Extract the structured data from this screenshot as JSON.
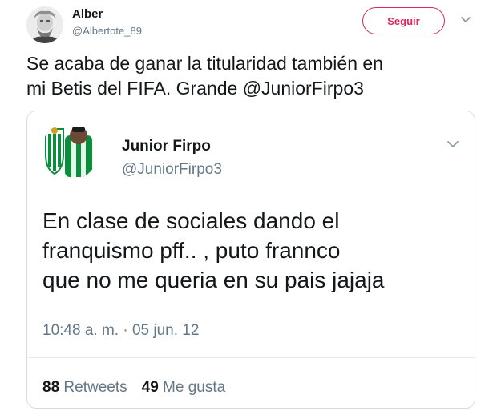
{
  "author": {
    "name": "Alber",
    "handle": "@Albertote_89",
    "follow_label": "Seguir"
  },
  "tweet": {
    "text_line1": "Se acaba de ganar la titularidad también en",
    "text_line2": "mi Betis del FIFA. Grande @JuniorFirpo3"
  },
  "quoted": {
    "name": "Junior Firpo",
    "handle": "@JuniorFirpo3",
    "text_line1": "En clase de sociales dando el",
    "text_line2": "franquismo pff.. , puto frannco",
    "text_line3": "que no me queria en su pais jajaja",
    "timestamp": "10:48 a. m. · 05 jun. 12",
    "retweets_count": "88",
    "retweets_label": "Retweets",
    "likes_count": "49",
    "likes_label": "Me gusta"
  },
  "icons": {
    "menu": "chevron-down-icon",
    "avatar": "user-avatar",
    "club_badge": "betis-crest-avatar"
  },
  "colors": {
    "follow_accent": "#e0245e",
    "secondary_text": "#657786",
    "border": "#d6dde2",
    "betis_green": "#0a8d3c"
  }
}
